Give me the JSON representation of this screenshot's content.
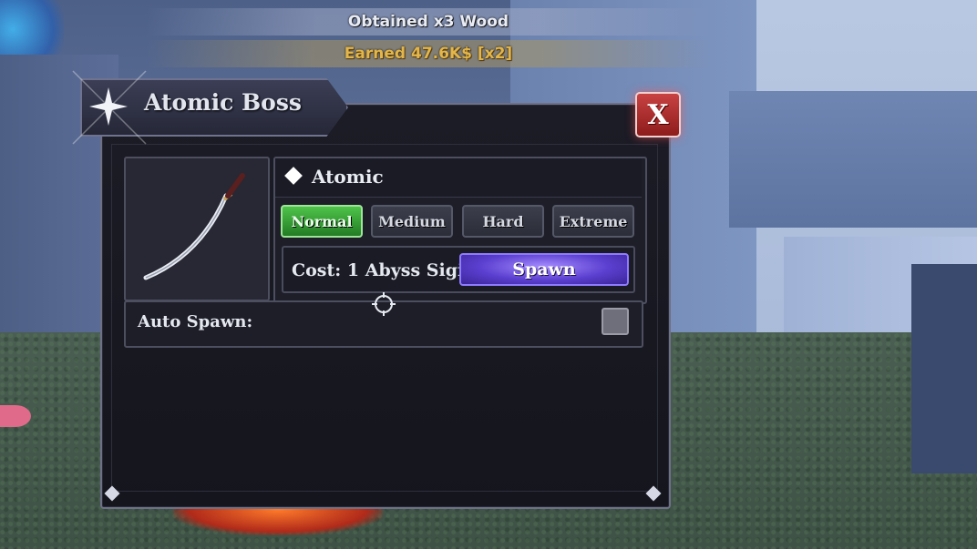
{
  "notifications": {
    "obtained": "Obtained x3 Wood",
    "earned": "Earned 47.6K$ [x2]"
  },
  "panel": {
    "title": "Atomic Boss",
    "close_label": "X",
    "boss_name": "Atomic",
    "difficulties": [
      {
        "label": "Normal",
        "selected": true
      },
      {
        "label": "Medium",
        "selected": false
      },
      {
        "label": "Hard",
        "selected": false
      },
      {
        "label": "Extreme",
        "selected": false
      }
    ],
    "cost_text": "Cost: 1 Abyss Sigil",
    "spawn_label": "Spawn",
    "auto_spawn_label": "Auto Spawn:",
    "auto_spawn_checked": false,
    "item_icon": "katana-icon"
  },
  "colors": {
    "active_difficulty": "#3fae3c",
    "spawn_button": "#5b3fd0",
    "close_button": "#b32b2b",
    "gold_text": "#e2b64a"
  }
}
